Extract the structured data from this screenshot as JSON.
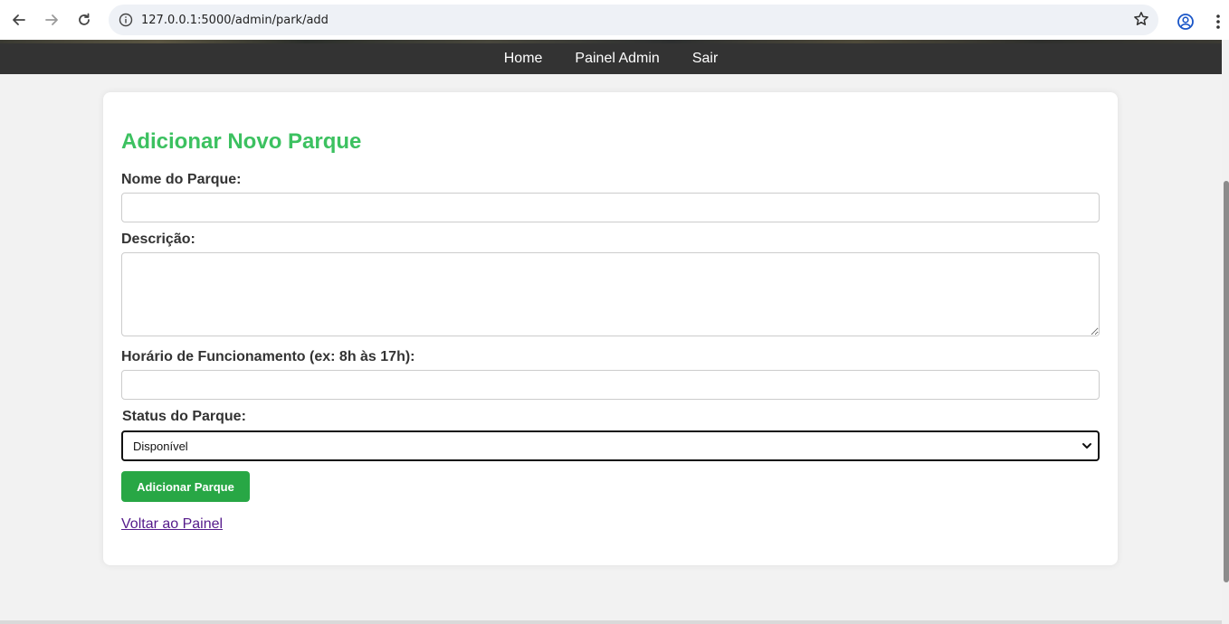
{
  "browser": {
    "url": "127.0.0.1:5000/admin/park/add"
  },
  "nav": {
    "items": [
      {
        "label": "Home"
      },
      {
        "label": "Painel Admin"
      },
      {
        "label": "Sair"
      }
    ]
  },
  "form": {
    "title": "Adicionar Novo Parque",
    "name_label": "Nome do Parque:",
    "name_value": "",
    "description_label": "Descrição:",
    "description_value": "",
    "hours_label": "Horário de Funcionamento (ex: 8h às 17h):",
    "hours_value": "",
    "status_label": "Status do Parque:",
    "status_selected": "Disponível",
    "submit_label": "Adicionar Parque",
    "back_link": "Voltar ao Painel"
  },
  "colors": {
    "title": "#3cc160",
    "submit": "#28a745",
    "navbar": "#333333",
    "link": "#551a8b"
  },
  "icons": [
    "back-arrow-icon",
    "forward-arrow-icon",
    "reload-icon",
    "site-info-icon",
    "bookmark-star-icon",
    "profile-icon",
    "kebab-menu-icon",
    "chevron-down-icon"
  ]
}
